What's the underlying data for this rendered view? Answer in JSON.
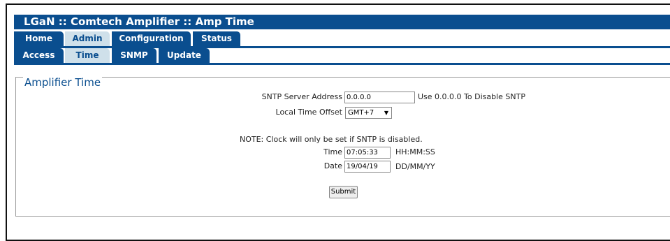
{
  "title": "LGaN :: Comtech Amplifier :: Amp Time",
  "tabs_row1": [
    {
      "label": "Home",
      "active": false
    },
    {
      "label": "Admin",
      "active": true
    },
    {
      "label": "Configuration",
      "active": false
    },
    {
      "label": "Status",
      "active": false
    }
  ],
  "tabs_row2": [
    {
      "label": "Access",
      "active": false
    },
    {
      "label": "Time",
      "active": true
    },
    {
      "label": "SNMP",
      "active": false
    },
    {
      "label": "Update",
      "active": false
    }
  ],
  "section": {
    "legend": "Amplifier Time",
    "sntp_label": "SNTP Server Address",
    "sntp_value": "0.0.0.0",
    "sntp_hint": "Use 0.0.0.0 To Disable SNTP",
    "offset_label": "Local Time Offset",
    "offset_value": "GMT+7",
    "note": "NOTE: Clock will only be set if SNTP is disabled.",
    "time_label": "Time",
    "time_value": "07:05:33",
    "time_hint": "HH:MM:SS",
    "date_label": "Date",
    "date_value": "19/04/19",
    "date_hint": "DD/MM/YY",
    "submit_label": "Submit"
  },
  "colors": {
    "brand": "#0a4e8f",
    "active_tab": "#cfe0ea"
  }
}
